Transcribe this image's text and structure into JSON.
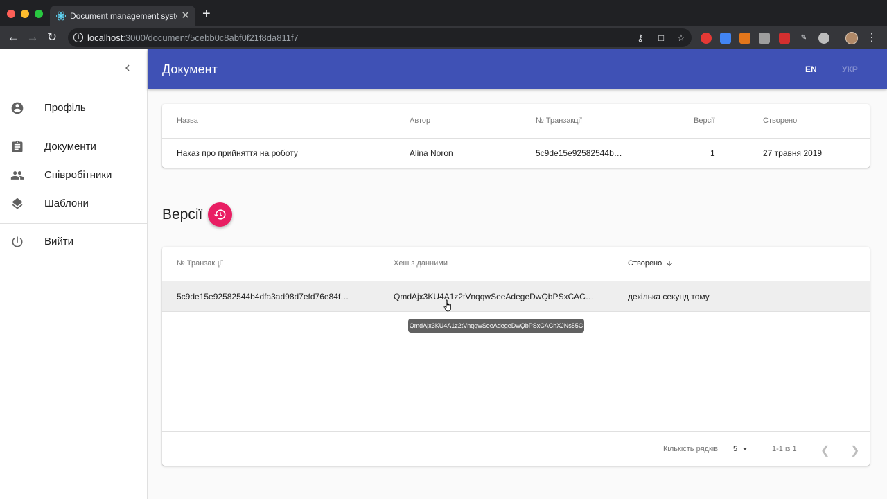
{
  "browser": {
    "tab_title": "Document management system",
    "tab_close": "✕",
    "new_tab": "+",
    "url_host": "localhost",
    "url_path": ":3000/document/5cebb0c8abf0f21f8da811f7"
  },
  "header": {
    "title": "Документ",
    "lang_en": "EN",
    "lang_ukr": "УКР"
  },
  "sidebar": {
    "items": [
      {
        "label": "Профіль",
        "icon": "account-circle-icon"
      },
      {
        "label": "Документи",
        "icon": "clipboard-icon"
      },
      {
        "label": "Співробітники",
        "icon": "people-icon"
      },
      {
        "label": "Шаблони",
        "icon": "layers-icon"
      },
      {
        "label": "Вийти",
        "icon": "power-icon"
      }
    ]
  },
  "document_table": {
    "headers": [
      "Назва",
      "Автор",
      "№ Транзакції",
      "Версії",
      "Створено"
    ],
    "row": [
      "Наказ про прийняття на роботу",
      "Alina Noron",
      "5c9de15e92582544b…",
      "1",
      "27 травня 2019"
    ]
  },
  "versions": {
    "title": "Версії",
    "headers": [
      "№ Транзакції",
      "Хеш з данними",
      "Створено"
    ],
    "row": [
      "5c9de15e92582544b4dfa3ad98d7efd76e84f…",
      "QmdAjx3KU4A1z2tVnqqwSeeAdegeDwQbPSxCAC…",
      "декілька секунд тому"
    ],
    "tooltip": "QmdAjx3KU4A1z2tVnqqwSeeAdegeDwQbPSxCAChXJNs55C",
    "pagination": {
      "rows_label": "Кількість рядків",
      "rows_value": "5",
      "range": "1-1 із 1"
    }
  },
  "colors": {
    "appbar": "#3f51b5",
    "fab": "#e91e63"
  }
}
